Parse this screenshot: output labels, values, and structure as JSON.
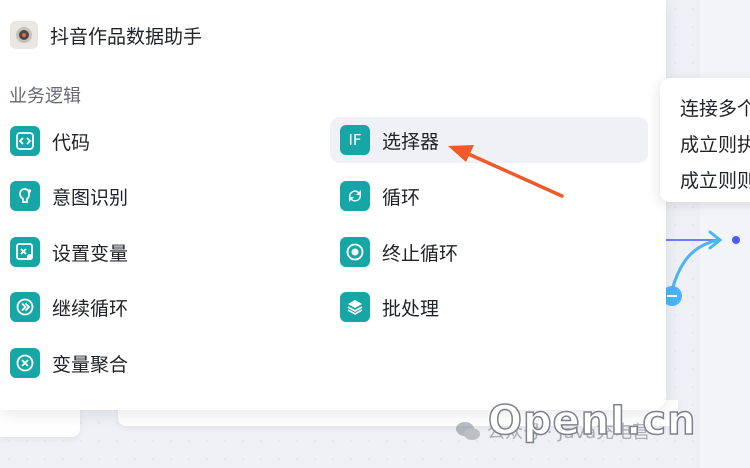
{
  "top_node": {
    "label": "抖音作品数据助手",
    "icon": "douyin-app-icon"
  },
  "section": {
    "title": "业务逻辑"
  },
  "nodes_left": [
    {
      "label": "代码",
      "icon": "code-icon"
    },
    {
      "label": "意图识别",
      "icon": "intent-icon"
    },
    {
      "label": "设置变量",
      "icon": "set-variable-icon"
    },
    {
      "label": "继续循环",
      "icon": "continue-loop-icon"
    },
    {
      "label": "变量聚合",
      "icon": "variable-aggregate-icon"
    }
  ],
  "nodes_right": [
    {
      "label": "选择器",
      "icon": "if-icon",
      "icon_text": "IF",
      "highlighted": true
    },
    {
      "label": "循环",
      "icon": "loop-icon"
    },
    {
      "label": "终止循环",
      "icon": "stop-loop-icon"
    },
    {
      "label": "批处理",
      "icon": "batch-icon"
    }
  ],
  "tooltip": {
    "lines": [
      "连接多个",
      "成立则执",
      "成立则则"
    ]
  },
  "watermark": {
    "text": "公众号 · Java充电营",
    "logo": "OpenI.cn"
  },
  "colors": {
    "accent": "#16a6a6",
    "arrow": "#f05a28",
    "connector": "#4c8dff"
  }
}
